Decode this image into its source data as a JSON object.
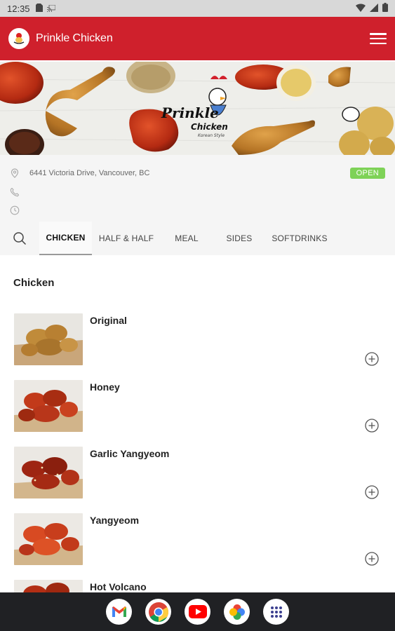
{
  "status_bar": {
    "time": "12:35"
  },
  "app_bar": {
    "title": "Prinkle Chicken"
  },
  "banner": {
    "brand_text": "Prinkle Chicken",
    "brand_sub": "Korean Style"
  },
  "info": {
    "address": "6441 Victoria Drive, Vancouver, BC",
    "phone": "",
    "hours": "",
    "status_badge": "OPEN"
  },
  "tabs": [
    {
      "label": "CHICKEN",
      "active": true
    },
    {
      "label": "HALF & HALF",
      "active": false
    },
    {
      "label": "MEAL",
      "active": false
    },
    {
      "label": "SIDES",
      "active": false
    },
    {
      "label": "SOFTDRINKS",
      "active": false
    }
  ],
  "section": {
    "title": "Chicken"
  },
  "menu_items": [
    {
      "name": "Original"
    },
    {
      "name": "Honey"
    },
    {
      "name": "Garlic Yangyeom"
    },
    {
      "name": "Yangyeom"
    },
    {
      "name": "Hot Volcano"
    }
  ],
  "dock_apps": [
    "gmail-icon",
    "chrome-icon",
    "youtube-icon",
    "photos-icon",
    "app-drawer-icon"
  ],
  "colors": {
    "brand_red": "#cf202c",
    "open_green": "#7ed257",
    "nav_bg": "#202124"
  }
}
